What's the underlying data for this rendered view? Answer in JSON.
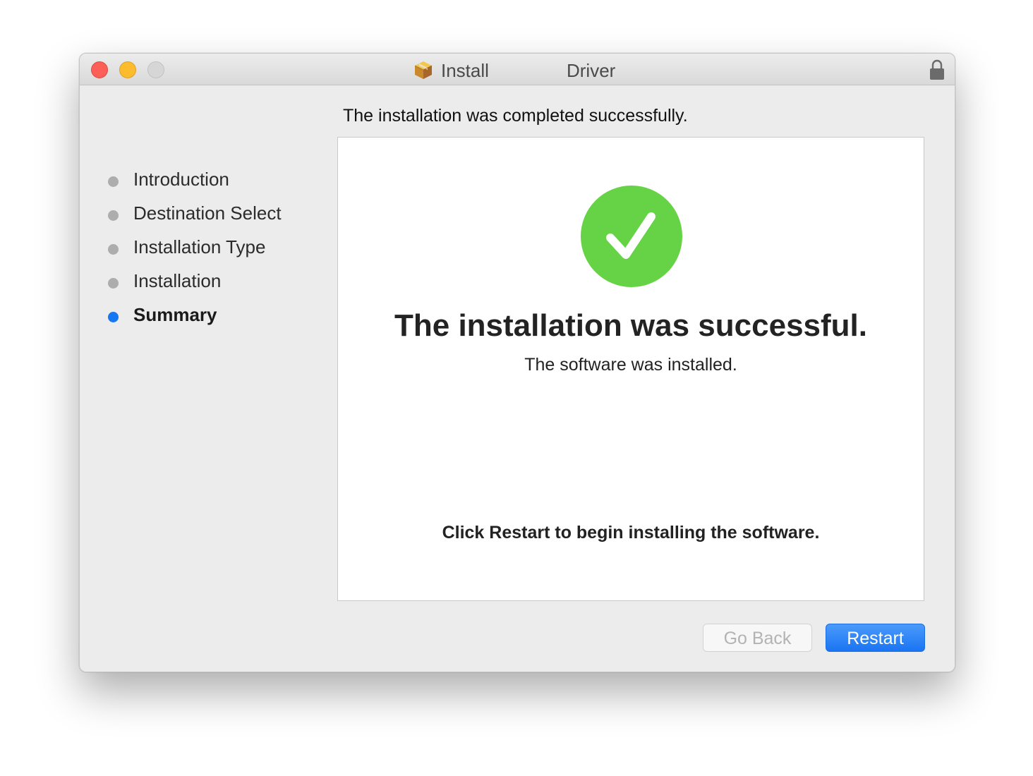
{
  "window": {
    "title_left": "Install",
    "title_right": "Driver"
  },
  "header": {
    "text": "The installation was completed successfully."
  },
  "sidebar": {
    "steps": [
      {
        "label": "Introduction",
        "active": false
      },
      {
        "label": "Destination Select",
        "active": false
      },
      {
        "label": "Installation Type",
        "active": false
      },
      {
        "label": "Installation",
        "active": false
      },
      {
        "label": "Summary",
        "active": true
      }
    ]
  },
  "main": {
    "success_title": "The installation was successful.",
    "success_subtitle": "The software was installed.",
    "restart_note": "Click Restart to begin installing the software."
  },
  "buttons": {
    "go_back": "Go Back",
    "restart": "Restart"
  },
  "icons": {
    "status": "checkmark-circle-icon",
    "title": "package-icon",
    "lock": "lock-icon"
  },
  "colors": {
    "accent": "#1677f2",
    "success": "#66d346",
    "close": "#fc5f57",
    "minimize": "#fdbc2e",
    "inactive_step": "#adadad"
  }
}
